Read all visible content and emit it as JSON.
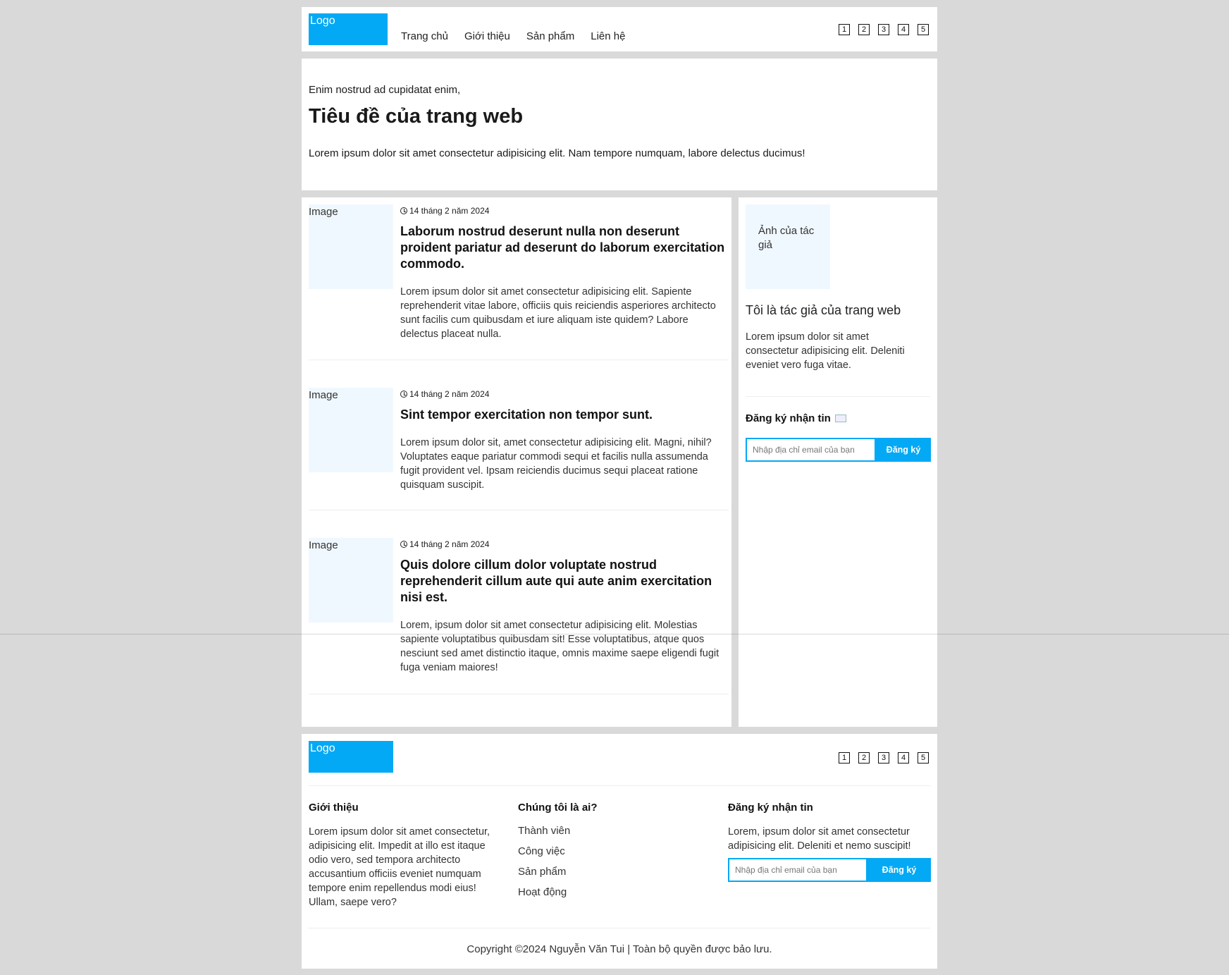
{
  "header": {
    "logo_alt": "Logo",
    "nav": [
      "Trang chủ",
      "Giới thiệu",
      "Sản phẩm",
      "Liên hệ"
    ],
    "pager": [
      "1",
      "2",
      "3",
      "4",
      "5"
    ]
  },
  "hero": {
    "eyebrow": "Enim nostrud ad cupidatat enim,",
    "title": "Tiêu đề của trang web",
    "description": "Lorem ipsum dolor sit amet consectetur adipisicing elit. Nam tempore numquam, labore delectus ducimus!"
  },
  "posts": [
    {
      "image_alt": "Image",
      "date": "14 tháng 2 năm 2024",
      "title": "Laborum nostrud deserunt nulla non deserunt proident pariatur ad deserunt do laborum exercitation commodo.",
      "excerpt": "Lorem ipsum dolor sit amet consectetur adipisicing elit. Sapiente reprehenderit vitae labore, officiis quis reiciendis asperiores architecto sunt facilis cum quibusdam et iure aliquam iste quidem? Labore delectus placeat nulla."
    },
    {
      "image_alt": "Image",
      "date": "14 tháng 2 năm 2024",
      "title": "Sint tempor exercitation non tempor sunt.",
      "excerpt": "Lorem ipsum dolor sit, amet consectetur adipisicing elit. Magni, nihil? Voluptates eaque pariatur commodi sequi et facilis nulla assumenda fugit provident vel. Ipsam reiciendis ducimus sequi placeat ratione quisquam suscipit."
    },
    {
      "image_alt": "Image",
      "date": "14 tháng 2 năm 2024",
      "title": "Quis dolore cillum dolor voluptate nostrud reprehenderit cillum aute qui aute anim exercitation nisi est.",
      "excerpt": "Lorem, ipsum dolor sit amet consectetur adipisicing elit. Molestias sapiente voluptatibus quibusdam sit! Esse voluptatibus, atque quos nesciunt sed amet distinctio itaque, omnis maxime saepe eligendi fugit fuga veniam maiores!"
    }
  ],
  "sidebar": {
    "author_image_alt": "Ảnh của tác giả",
    "author_title": "Tôi là tác giả của trang web",
    "author_text": "Lorem ipsum dolor sit amet consectetur adipisicing elit. Deleniti eveniet vero fuga vitae.",
    "subscribe_title": "Đăng ký nhận tin",
    "email_placeholder": "Nhập địa chỉ email của bạn",
    "subscribe_button": "Đăng ký"
  },
  "footer": {
    "logo_alt": "Logo",
    "pager": [
      "1",
      "2",
      "3",
      "4",
      "5"
    ],
    "about_title": "Giới thiệu",
    "about_text": "Lorem ipsum dolor sit amet consectetur, adipisicing elit. Impedit at illo est itaque odio vero, sed tempora architecto accusantium officiis eveniet numquam tempore enim repellendus modi eius! Ullam, saepe vero?",
    "who_title": "Chúng tôi là ai?",
    "who_links": [
      "Thành viên",
      "Công việc",
      "Sản phẩm",
      "Hoạt động"
    ],
    "subscribe_title": "Đăng ký nhận tin",
    "subscribe_text": "Lorem, ipsum dolor sit amet consectetur adipisicing elit. Deleniti et nemo suscipit!",
    "email_placeholder": "Nhập địa chỉ email của bạn",
    "subscribe_button": "Đăng ký",
    "copyright": "Copyright ©2024 Nguyễn Văn Tui | Toàn bộ quyền được bảo lưu."
  },
  "colors": {
    "accent": "#03a9f4",
    "page_bg": "#d9d9d9",
    "thumb_bg": "#f0f8ff"
  }
}
